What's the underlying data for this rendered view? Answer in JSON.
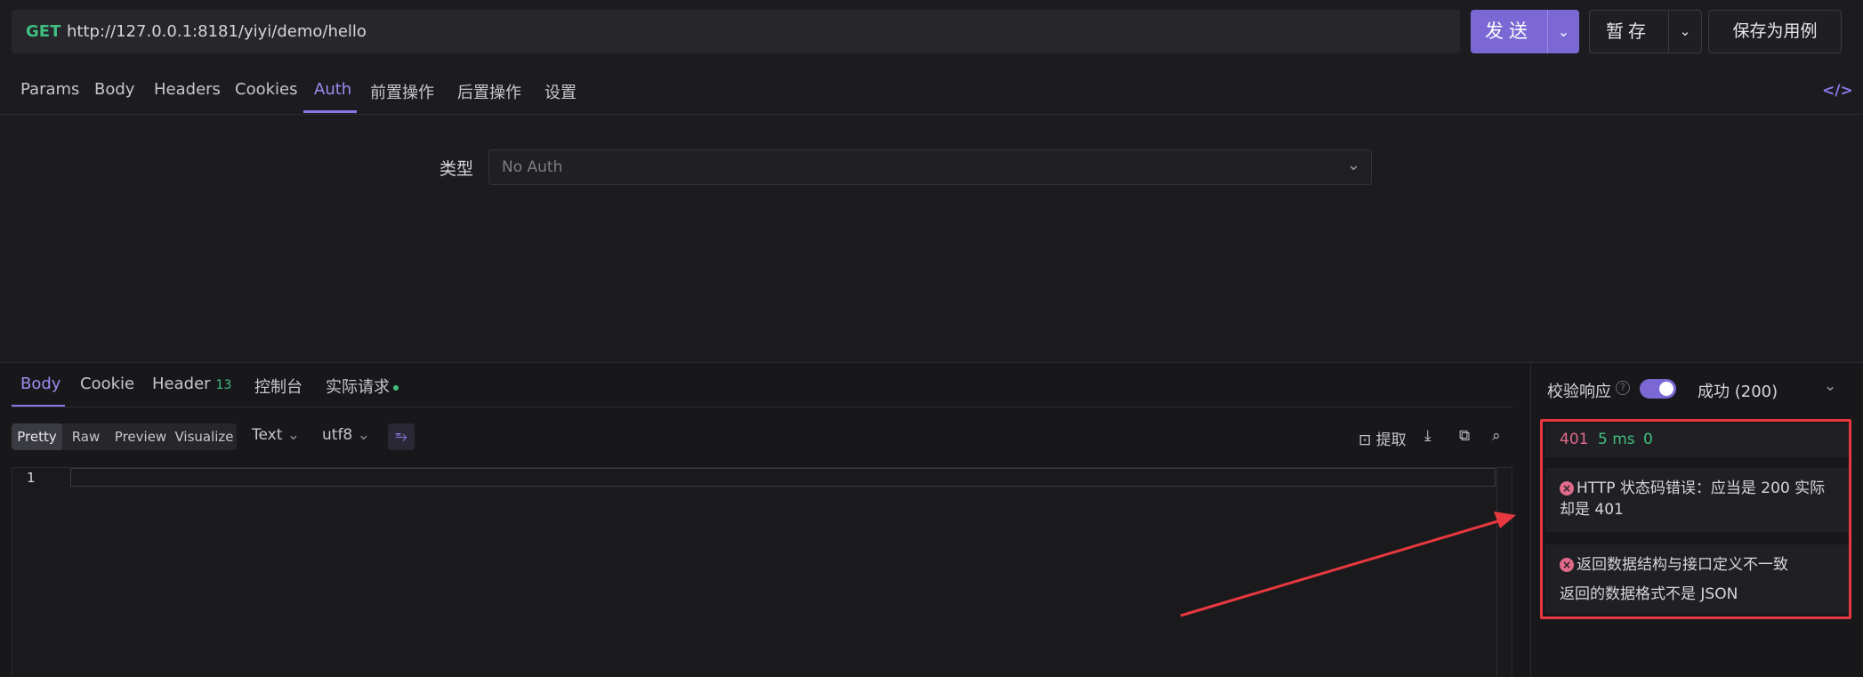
{
  "request": {
    "method": "GET",
    "url": "http://127.0.0.1:8181/yiyi/demo/hello",
    "send_label": "发送",
    "stash_label": "暂存",
    "save_as_case_label": "保存为用例",
    "dropdown_glyph": "⌄"
  },
  "request_tabs": [
    "Params",
    "Body",
    "Headers",
    "Cookies",
    "Auth",
    "前置操作",
    "后置操作",
    "设置"
  ],
  "request_tab_active": "Auth",
  "code_toggle_glyph": "</>",
  "auth": {
    "type_label": "类型",
    "type_value": "No Auth"
  },
  "response_tabs": {
    "body": "Body",
    "cookie": "Cookie",
    "header": "Header",
    "header_count": "13",
    "console": "控制台",
    "actual_request": "实际请求"
  },
  "response_tab_active": "Body",
  "view_modes": [
    "Pretty",
    "Raw",
    "Preview",
    "Visualize"
  ],
  "view_mode_active": "Pretty",
  "format": {
    "type": "Text",
    "encoding": "utf8"
  },
  "tools": {
    "extract": "提取"
  },
  "editor": {
    "line_numbers": [
      "1"
    ]
  },
  "verify": {
    "label": "校验响应",
    "enabled": true,
    "result": "成功 (200)"
  },
  "status": {
    "code": "401",
    "time": "5 ms",
    "size": "0"
  },
  "errors": [
    {
      "lines": [
        "HTTP 状态码错误：应当是 200 实际",
        "却是 401"
      ]
    },
    {
      "lines": [
        "返回数据结构与接口定义不一致",
        "返回的数据格式不是 JSON"
      ]
    }
  ],
  "colors": {
    "accent": "#7b68d4",
    "success": "#3fbf7f",
    "error": "#e06a8a",
    "annotation": "#e8383f"
  }
}
